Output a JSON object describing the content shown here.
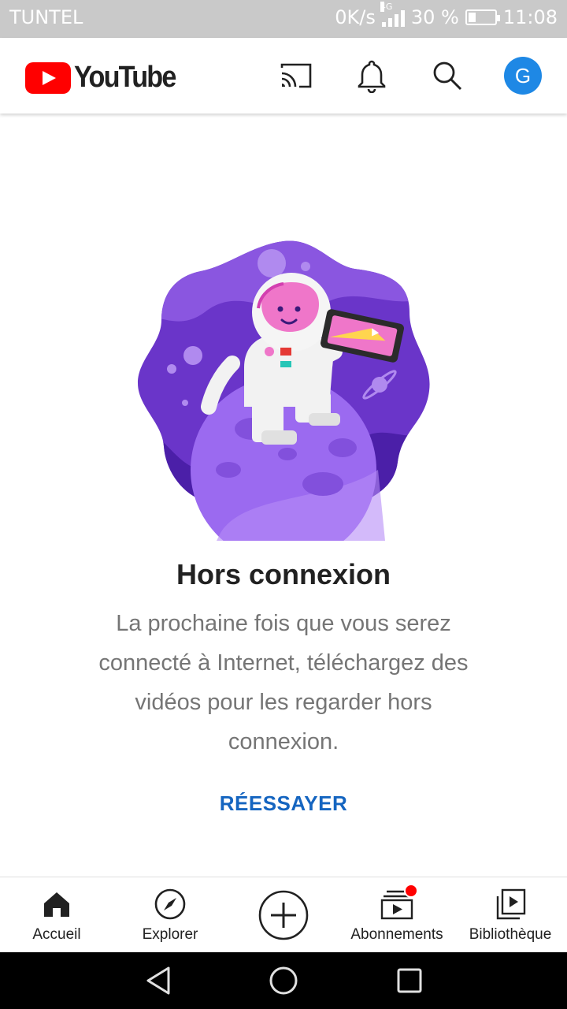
{
  "status_bar": {
    "carrier": "TUNTEL",
    "speed": "0K/s",
    "network": "4G",
    "battery": "30 %",
    "battery_level": 0.3,
    "time": "11:08"
  },
  "app_bar": {
    "brand": "YouTube",
    "avatar_letter": "G",
    "icons": [
      "cast-icon",
      "bell-icon",
      "search-icon"
    ]
  },
  "offline": {
    "title": "Hors connexion",
    "message": "La prochaine fois que vous serez connecté à Internet, téléchargez des vidéos pour les regarder hors connexion.",
    "retry_label": "RÉESSAYER"
  },
  "bottom_nav": {
    "items": [
      {
        "label": "Accueil",
        "icon": "home-icon"
      },
      {
        "label": "Explorer",
        "icon": "compass-icon"
      },
      {
        "label": "",
        "icon": "add-icon"
      },
      {
        "label": "Abonnements",
        "icon": "subscriptions-icon"
      },
      {
        "label": "Bibliothèque",
        "icon": "library-icon"
      }
    ]
  },
  "colors": {
    "brand_red": "#ff0000",
    "link_blue": "#1565c0",
    "avatar_blue": "#1e88e5",
    "illustration_purple": "#6a35c9"
  }
}
